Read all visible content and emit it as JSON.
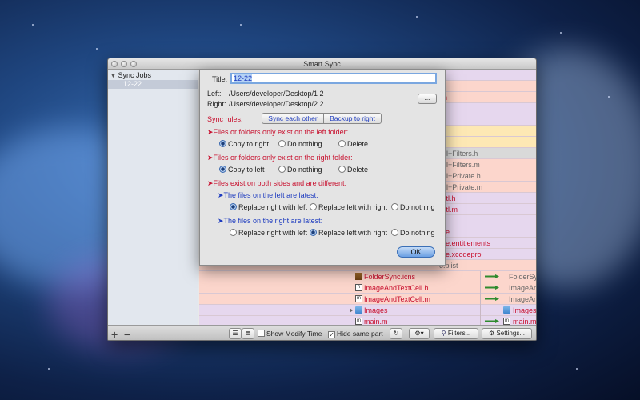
{
  "window": {
    "title": "Smart Sync"
  },
  "sidebar": {
    "group_label": "Sync Jobs",
    "items": [
      {
        "label": "12-22"
      }
    ]
  },
  "dialog": {
    "title_label": "Title:",
    "title_value": "12-22",
    "left_label": "Left:",
    "left_path": "/Users/developer/Desktop/1 2",
    "right_label": "Right:",
    "right_path": "/Users/developer/Desktop/2 2",
    "browse_label": "...",
    "sync_rules_label": "Sync rules:",
    "sync_each_other": "Sync each other",
    "backup_to_right": "Backup to right",
    "section_left_only": "➤Files or folders only exist on the left folder:",
    "left_only_options": [
      "Copy to right",
      "Do nothing",
      "Delete"
    ],
    "section_right_only": "➤Files or folders only exist on the right folder:",
    "right_only_options": [
      "Copy to left",
      "Do nothing",
      "Delete"
    ],
    "section_both": "➤Files exist on both sides and are different:",
    "sub_left_latest": "➤The files on the left are latest:",
    "left_latest_options": [
      "Replace right with left",
      "Replace left with right",
      "Do nothing"
    ],
    "sub_right_latest": "➤The files on the right are latest:",
    "right_latest_options": [
      "Replace right with left",
      "Replace left with right",
      "Do nothing"
    ],
    "ok_label": "OK"
  },
  "rows_right_partial": [
    ".m",
    "Ctl+Filters.h",
    "Ctl+Filters.m",
    "Ctl+Private.h",
    "Ctl+Private.m",
    "lCtl.h",
    "lCtl.m",
    "are",
    "are.entitlements",
    "are.xcodeproj",
    "o.plist"
  ],
  "rows": [
    {
      "left": "FolderSync.icns",
      "right": "FolderSync.icns"
    },
    {
      "left": "ImageAndTextCell.h",
      "right": "ImageAndTextCell.h"
    },
    {
      "left": "ImageAndTextCell.m",
      "right": "ImageAndTextCell.m"
    },
    {
      "left": "Images",
      "right": "Images"
    },
    {
      "left": "main.m",
      "right": "main.m"
    }
  ],
  "bottombar": {
    "show_modify_time": "Show Modify Time",
    "hide_same_part": "Hide same part",
    "filters": "Filters...",
    "settings": "Settings..."
  },
  "colors": {
    "row_pink": "#fcd6cc",
    "row_lavender": "#e6d7ee",
    "accent_red": "#c8102e",
    "accent_blue": "#1d3bbf"
  }
}
